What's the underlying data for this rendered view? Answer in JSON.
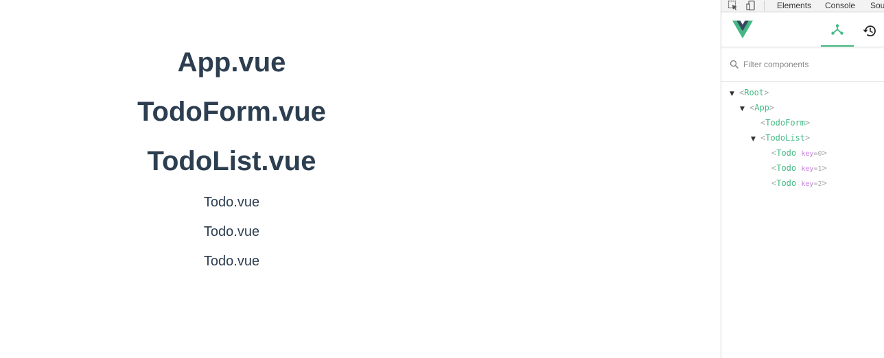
{
  "page": {
    "headings": [
      "App.vue",
      "TodoForm.vue",
      "TodoList.vue"
    ],
    "todos": [
      "Todo.vue",
      "Todo.vue",
      "Todo.vue"
    ]
  },
  "devtools": {
    "tabs": [
      "Elements",
      "Console",
      "Sou"
    ],
    "filter": {
      "placeholder": "Filter components",
      "value": ""
    },
    "tree": {
      "open_bracket": "<",
      "close_bracket": ">",
      "nodes": [
        {
          "name": "Root",
          "expanded": true
        },
        {
          "name": "App",
          "expanded": true
        },
        {
          "name": "TodoForm",
          "expanded": false
        },
        {
          "name": "TodoList",
          "expanded": true
        },
        {
          "name": "Todo",
          "key_label": "key",
          "eq": "=",
          "key_value": "0"
        },
        {
          "name": "Todo",
          "key_label": "key",
          "eq": "=",
          "key_value": "1"
        },
        {
          "name": "Todo",
          "key_label": "key",
          "eq": "=",
          "key_value": "2"
        }
      ]
    },
    "colors": {
      "accent": "#42b983",
      "key": "#c678dd",
      "bracket": "#a8a8a8",
      "text": "#2c3e50"
    },
    "icons": [
      "inspect-icon",
      "device-icon",
      "vue-logo-icon",
      "components-icon",
      "history-icon",
      "search-icon",
      "expand-arrow-icon"
    ]
  }
}
